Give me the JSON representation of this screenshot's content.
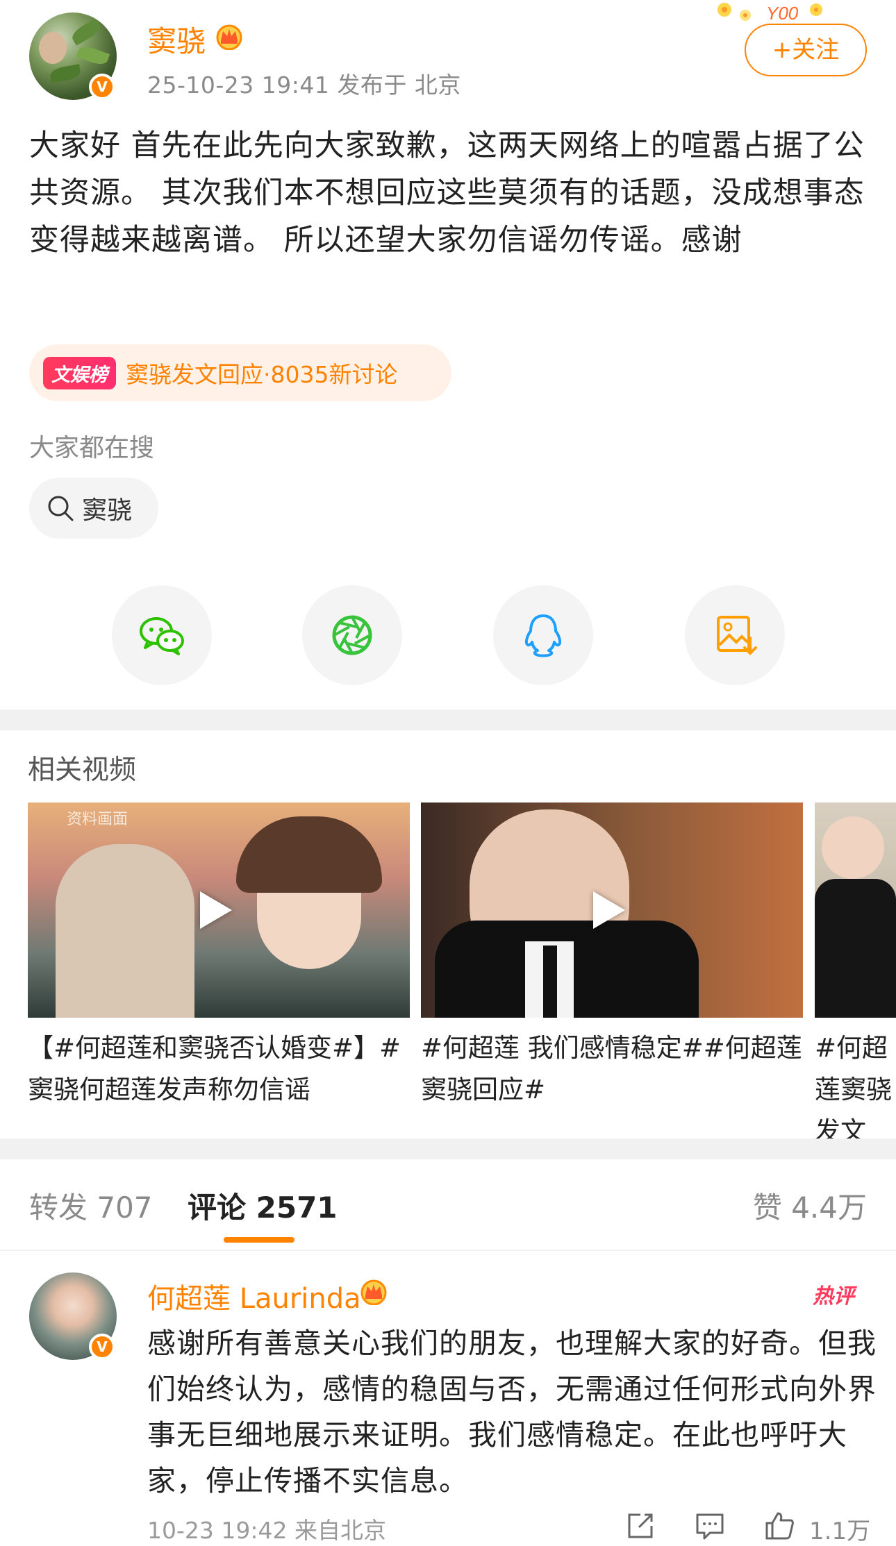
{
  "post": {
    "author": "窦骁",
    "meta": "25-10-23 19:41  发布于 北京",
    "follow_label": "+关注",
    "text": "大家好 首先在此先向大家致歉，这两天网络上的喧嚣占据了公共资源。 其次我们本不想回应这些莫须有的话题，没成想事态变得越来越离谱。 所以还望大家勿信谣勿传谣。感谢",
    "trend_badge": "文娱榜",
    "trend_text": "窦骁发文回应·8035新讨论",
    "search_title": "大家都在搜",
    "search_chip": "窦骁"
  },
  "share": {
    "items": [
      {
        "name": "wechat",
        "icon": "wechat-icon",
        "color": "#2dc100"
      },
      {
        "name": "moments",
        "icon": "moments-icon",
        "color": "#37c33c"
      },
      {
        "name": "qq",
        "icon": "qq-icon",
        "color": "#1ea0ff"
      },
      {
        "name": "save-image",
        "icon": "save-image-icon",
        "color": "#ff9f00"
      }
    ]
  },
  "related": {
    "title": "相关视频",
    "videos": [
      {
        "caption": "【#何超莲和窦骁否认婚变#】#窦骁何超莲发声称勿信谣",
        "watermark": "资料画面"
      },
      {
        "caption": "#何超莲 我们感情稳定##何超莲窦骁回应#"
      },
      {
        "caption": "#何超莲窦骁发文"
      }
    ]
  },
  "tabs": {
    "repost": "转发 707",
    "comment": "评论 2571",
    "like": "赞 4.4万"
  },
  "comment": {
    "author": "何超莲 Laurinda",
    "hot_tag": "热评",
    "text": "感谢所有善意关心我们的朋友，也理解大家的好奇。但我们始终认为，感情的稳固与否，无需通过任何形式向外界事无巨细地展示来证明。我们感情稳定。在此也呼吁大家，停止传播不实信息。",
    "meta": "10-23 19:42 来自北京",
    "likes": "1.1万"
  },
  "colors": {
    "accent": "#ff8200",
    "hot": "#ff3a5c"
  }
}
